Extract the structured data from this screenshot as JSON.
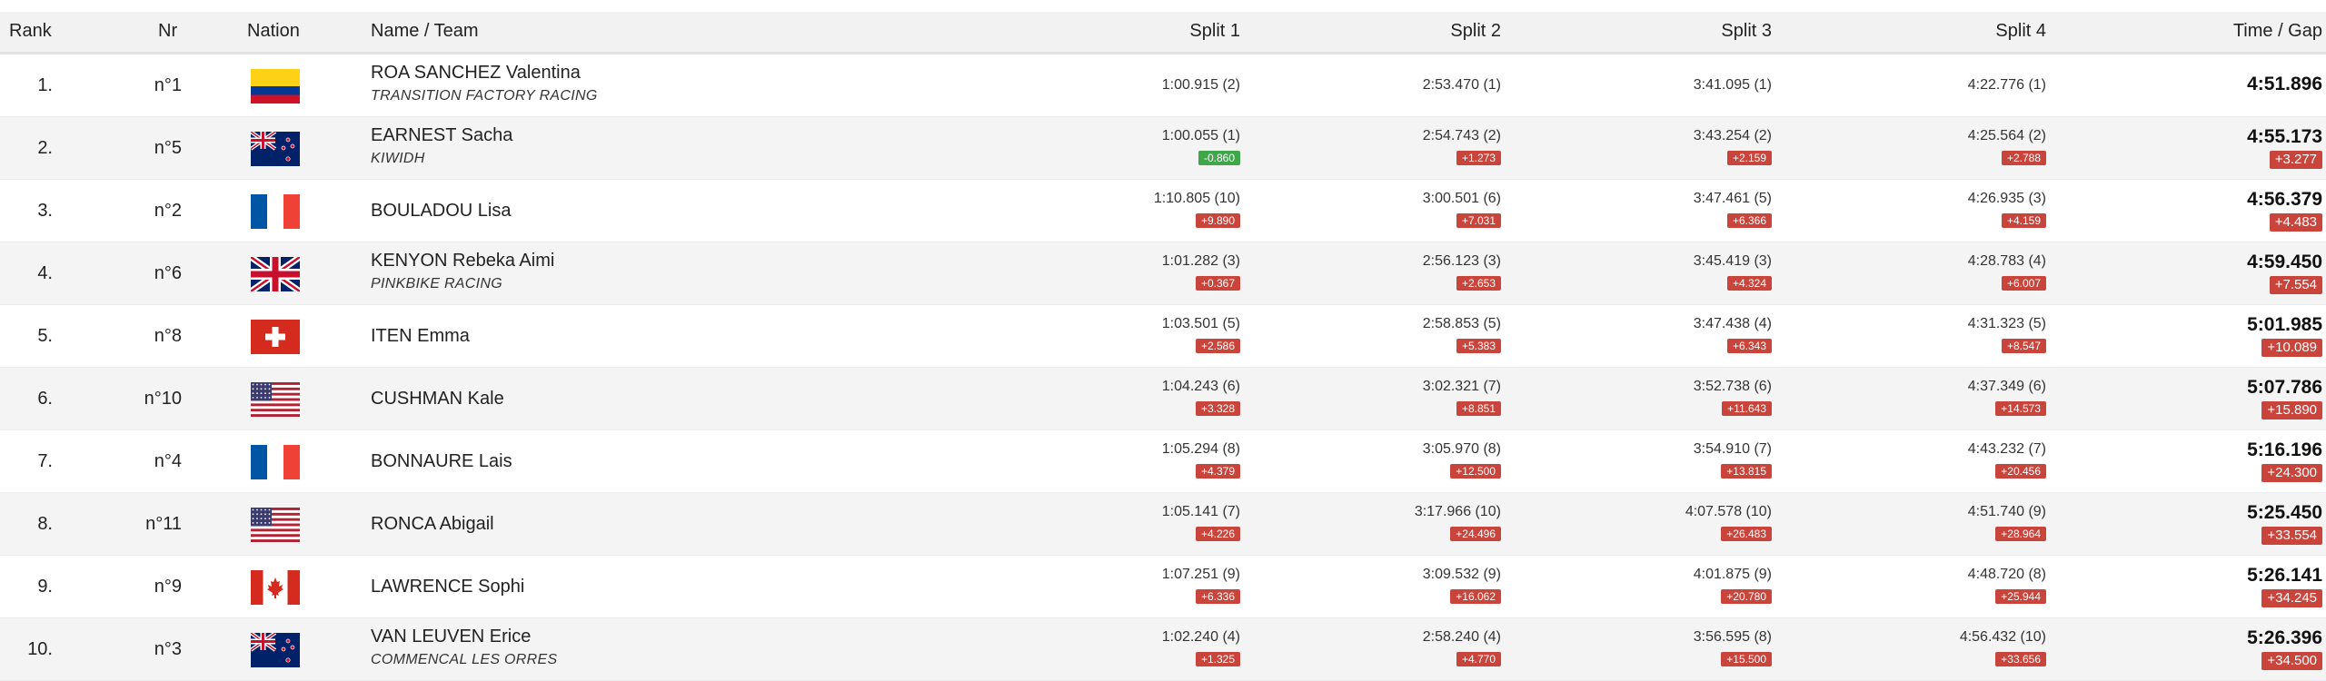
{
  "header": {
    "rank": "Rank",
    "nr": "Nr",
    "nation": "Nation",
    "name_team": "Name / Team",
    "split1": "Split 1",
    "split2": "Split 2",
    "split3": "Split 3",
    "split4": "Split 4",
    "time_gap": "Time / Gap"
  },
  "colors": {
    "gap_positive": "#c9453c",
    "gap_negative": "#3fa64a",
    "row_alt": "#f4f4f4"
  },
  "rows": [
    {
      "rank": "1.",
      "nr": "n°1",
      "flag": "colombia-flag-icon",
      "name": "ROA SANCHEZ Valentina",
      "team": "TRANSITION FACTORY RACING",
      "s1": "1:00.915 (2)",
      "s1g": "",
      "s2": "2:53.470 (1)",
      "s2g": "",
      "s3": "3:41.095 (1)",
      "s3g": "",
      "s4": "4:22.776 (1)",
      "s4g": "",
      "time": "4:51.896",
      "gap": ""
    },
    {
      "rank": "2.",
      "nr": "n°5",
      "flag": "new-zealand-flag-icon",
      "name": "EARNEST Sacha",
      "team": "KIWIDH",
      "s1": "1:00.055 (1)",
      "s1g": "-0.860",
      "s2": "2:54.743 (2)",
      "s2g": "+1.273",
      "s3": "3:43.254 (2)",
      "s3g": "+2.159",
      "s4": "4:25.564 (2)",
      "s4g": "+2.788",
      "time": "4:55.173",
      "gap": "+3.277"
    },
    {
      "rank": "3.",
      "nr": "n°2",
      "flag": "france-flag-icon",
      "name": "BOULADOU Lisa",
      "team": "",
      "s1": "1:10.805 (10)",
      "s1g": "+9.890",
      "s2": "3:00.501 (6)",
      "s2g": "+7.031",
      "s3": "3:47.461 (5)",
      "s3g": "+6.366",
      "s4": "4:26.935 (3)",
      "s4g": "+4.159",
      "time": "4:56.379",
      "gap": "+4.483"
    },
    {
      "rank": "4.",
      "nr": "n°6",
      "flag": "uk-flag-icon",
      "name": "KENYON Rebeka Aimi",
      "team": "PINKBIKE RACING",
      "s1": "1:01.282 (3)",
      "s1g": "+0.367",
      "s2": "2:56.123 (3)",
      "s2g": "+2.653",
      "s3": "3:45.419 (3)",
      "s3g": "+4.324",
      "s4": "4:28.783 (4)",
      "s4g": "+6.007",
      "time": "4:59.450",
      "gap": "+7.554"
    },
    {
      "rank": "5.",
      "nr": "n°8",
      "flag": "switzerland-flag-icon",
      "name": "ITEN Emma",
      "team": "",
      "s1": "1:03.501 (5)",
      "s1g": "+2.586",
      "s2": "2:58.853 (5)",
      "s2g": "+5.383",
      "s3": "3:47.438 (4)",
      "s3g": "+6.343",
      "s4": "4:31.323 (5)",
      "s4g": "+8.547",
      "time": "5:01.985",
      "gap": "+10.089"
    },
    {
      "rank": "6.",
      "nr": "n°10",
      "flag": "usa-flag-icon",
      "name": "CUSHMAN Kale",
      "team": "",
      "s1": "1:04.243 (6)",
      "s1g": "+3.328",
      "s2": "3:02.321 (7)",
      "s2g": "+8.851",
      "s3": "3:52.738 (6)",
      "s3g": "+11.643",
      "s4": "4:37.349 (6)",
      "s4g": "+14.573",
      "time": "5:07.786",
      "gap": "+15.890"
    },
    {
      "rank": "7.",
      "nr": "n°4",
      "flag": "france-flag-icon",
      "name": "BONNAURE Lais",
      "team": "",
      "s1": "1:05.294 (8)",
      "s1g": "+4.379",
      "s2": "3:05.970 (8)",
      "s2g": "+12.500",
      "s3": "3:54.910 (7)",
      "s3g": "+13.815",
      "s4": "4:43.232 (7)",
      "s4g": "+20.456",
      "time": "5:16.196",
      "gap": "+24.300"
    },
    {
      "rank": "8.",
      "nr": "n°11",
      "flag": "usa-flag-icon",
      "name": "RONCA Abigail",
      "team": "",
      "s1": "1:05.141 (7)",
      "s1g": "+4.226",
      "s2": "3:17.966 (10)",
      "s2g": "+24.496",
      "s3": "4:07.578 (10)",
      "s3g": "+26.483",
      "s4": "4:51.740 (9)",
      "s4g": "+28.964",
      "time": "5:25.450",
      "gap": "+33.554"
    },
    {
      "rank": "9.",
      "nr": "n°9",
      "flag": "canada-flag-icon",
      "name": "LAWRENCE Sophi",
      "team": "",
      "s1": "1:07.251 (9)",
      "s1g": "+6.336",
      "s2": "3:09.532 (9)",
      "s2g": "+16.062",
      "s3": "4:01.875 (9)",
      "s3g": "+20.780",
      "s4": "4:48.720 (8)",
      "s4g": "+25.944",
      "time": "5:26.141",
      "gap": "+34.245"
    },
    {
      "rank": "10.",
      "nr": "n°3",
      "flag": "new-zealand-flag-icon",
      "name": "VAN LEUVEN Erice",
      "team": "COMMENCAL LES ORRES",
      "s1": "1:02.240 (4)",
      "s1g": "+1.325",
      "s2": "2:58.240 (4)",
      "s2g": "+4.770",
      "s3": "3:56.595 (8)",
      "s3g": "+15.500",
      "s4": "4:56.432 (10)",
      "s4g": "+33.656",
      "time": "5:26.396",
      "gap": "+34.500"
    }
  ]
}
